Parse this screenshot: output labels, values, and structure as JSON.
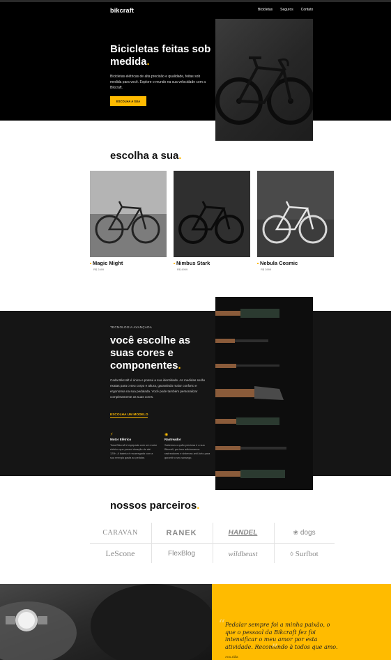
{
  "header": {
    "logo": "bikcraft",
    "nav": [
      "Bicicletas",
      "Seguros",
      "Contato"
    ]
  },
  "hero": {
    "title": "Bicicletas feitas sob medida",
    "title_dot": ".",
    "text": "Bicicletas elétricas de alta precisão e qualidade, feitas sob medida para você. Explore o mundo na sua velocidade com a Bikcraft.",
    "button": "ESCOLHA A SUA"
  },
  "products": {
    "title": "escolha a sua",
    "title_dot": ".",
    "items": [
      {
        "name": "Magic Might",
        "price": "R$ 2499"
      },
      {
        "name": "Nimbus Stark",
        "price": "R$ 4999"
      },
      {
        "name": "Nebula Cosmic",
        "price": "R$ 3999"
      }
    ]
  },
  "tech": {
    "eyebrow": "TECNOLOGIA AVANÇADA",
    "title": "você escolhe as suas cores e componentes",
    "title_dot": ".",
    "text": "Cada Bikcraft é única e possui a sua identidade. As medidas serão exatas para o seu corpo e altura, garantindo maior conforto e ergonomia na sua pedalada. Você pode também personalizar completamente as suas cores.",
    "link": "ESCOLHA UM MODELO",
    "features": [
      {
        "icon": "⚡",
        "title": "Motor Elétrico",
        "text": "Toda Bikcraft é equipada com um motor elétrico que possui duração de até 120h. A bateria é recarregada com a sua energia gasta ao pedalar."
      },
      {
        "icon": "◉",
        "title": "Rastreador",
        "text": "Sabemos o quão preciosa é a sua Bikcraft, por isso adicionamos rastreadores e sistemas anti-furto para garantir o seu sossego."
      }
    ]
  },
  "partners": {
    "title": "nossos parceiros",
    "title_dot": ".",
    "logos": [
      "CARAVAN",
      "RANEK",
      "HANDEL",
      "dogs",
      "LeScone",
      "FlexBlog",
      "wildbeast",
      "Surfbot"
    ]
  },
  "testimonial": {
    "open_quote": "“",
    "close_quote": "”",
    "quote": "Pedalar sempre foi a minha paixão, o que o pessoal da Bikcraft fez foi intensificar o meu amor por esta atividade. Recomendo à todos que amo.",
    "author": "Ana Júlia"
  },
  "colors": {
    "accent": "#ffbb00",
    "dark": "#000000",
    "dark_section": "#151515"
  }
}
